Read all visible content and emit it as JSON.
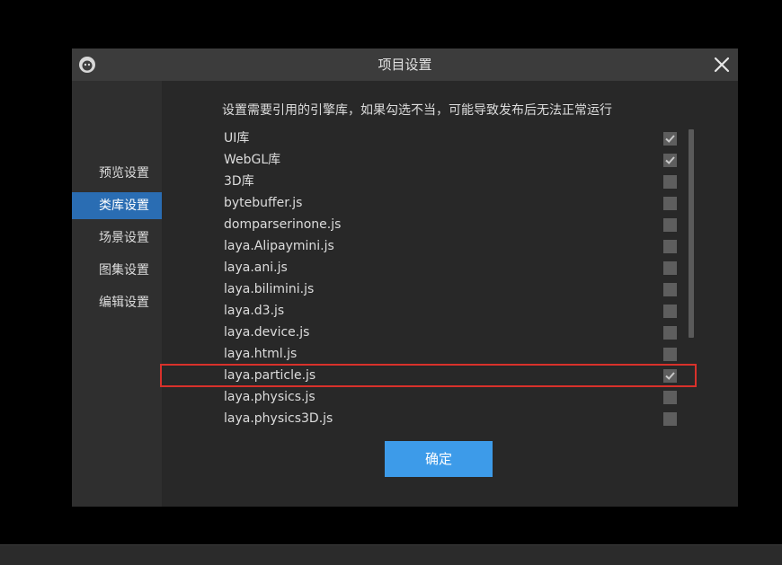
{
  "window": {
    "title": "项目设置",
    "logo_icon": "laya-logo-icon",
    "close_icon": "close-icon"
  },
  "sidebar": {
    "items": [
      {
        "label": "预览设置",
        "active": false
      },
      {
        "label": "类库设置",
        "active": true
      },
      {
        "label": "场景设置",
        "active": false
      },
      {
        "label": "图集设置",
        "active": false
      },
      {
        "label": "编辑设置",
        "active": false
      }
    ]
  },
  "content": {
    "description": "设置需要引用的引擎库，如果勾选不当，可能导致发布后无法正常运行",
    "libraries": [
      {
        "name": "UI库",
        "checked": true
      },
      {
        "name": "WebGL库",
        "checked": true
      },
      {
        "name": "3D库",
        "checked": false
      },
      {
        "name": "bytebuffer.js",
        "checked": false
      },
      {
        "name": "domparserinone.js",
        "checked": false
      },
      {
        "name": "laya.Alipaymini.js",
        "checked": false
      },
      {
        "name": "laya.ani.js",
        "checked": false
      },
      {
        "name": "laya.bilimini.js",
        "checked": false
      },
      {
        "name": "laya.d3.js",
        "checked": false
      },
      {
        "name": "laya.device.js",
        "checked": false
      },
      {
        "name": "laya.html.js",
        "checked": false
      },
      {
        "name": "laya.particle.js",
        "checked": true
      },
      {
        "name": "laya.physics.js",
        "checked": false
      },
      {
        "name": "laya.physics3D.js",
        "checked": false
      }
    ],
    "confirm_label": "确定"
  },
  "colors": {
    "accent": "#2a6db3",
    "button": "#3d9be9",
    "highlight": "#d9312b"
  }
}
